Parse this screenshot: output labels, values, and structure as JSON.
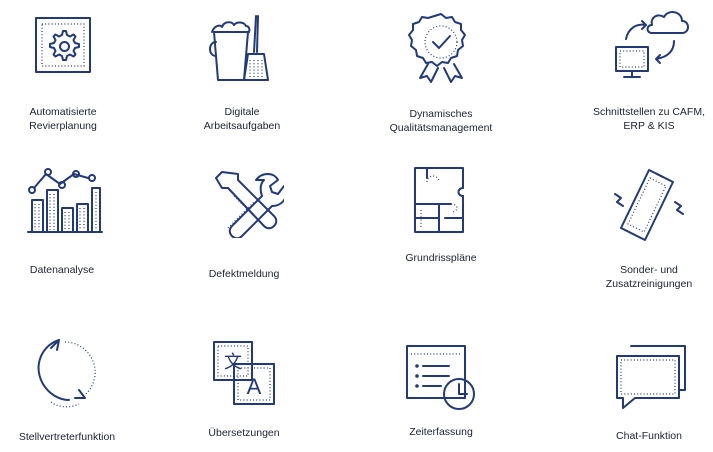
{
  "features": [
    {
      "icon": "gear-icon",
      "label": "Automatisierte\nRevierplanung"
    },
    {
      "icon": "bucket-brush-icon",
      "label": "Digitale\nArbeitsaufgaben"
    },
    {
      "icon": "quality-badge-icon",
      "label": "Dynamisches\nQualitätsmanagement"
    },
    {
      "icon": "cloud-sync-icon",
      "label": "Schnittstellen zu CAFM,\nERP & KIS"
    },
    {
      "icon": "bar-chart-icon",
      "label": "Datenanalyse"
    },
    {
      "icon": "tools-icon",
      "label": "Defektmeldung"
    },
    {
      "icon": "floor-plan-icon",
      "label": "Grundrisspläne"
    },
    {
      "icon": "phone-vibrate-icon",
      "label": "Sonder- und\nZusatzreinigungen"
    },
    {
      "icon": "rotate-arrows-icon",
      "label": "Stellvertreterfunktion"
    },
    {
      "icon": "translate-icon",
      "label": "Übersetzungen"
    },
    {
      "icon": "time-tracking-icon",
      "label": "Zeiterfassung"
    },
    {
      "icon": "chat-icon",
      "label": "Chat-Funktion"
    }
  ],
  "colors": {
    "icon": "#233a7a",
    "text": "#1c2233",
    "background": "#ffffff"
  }
}
